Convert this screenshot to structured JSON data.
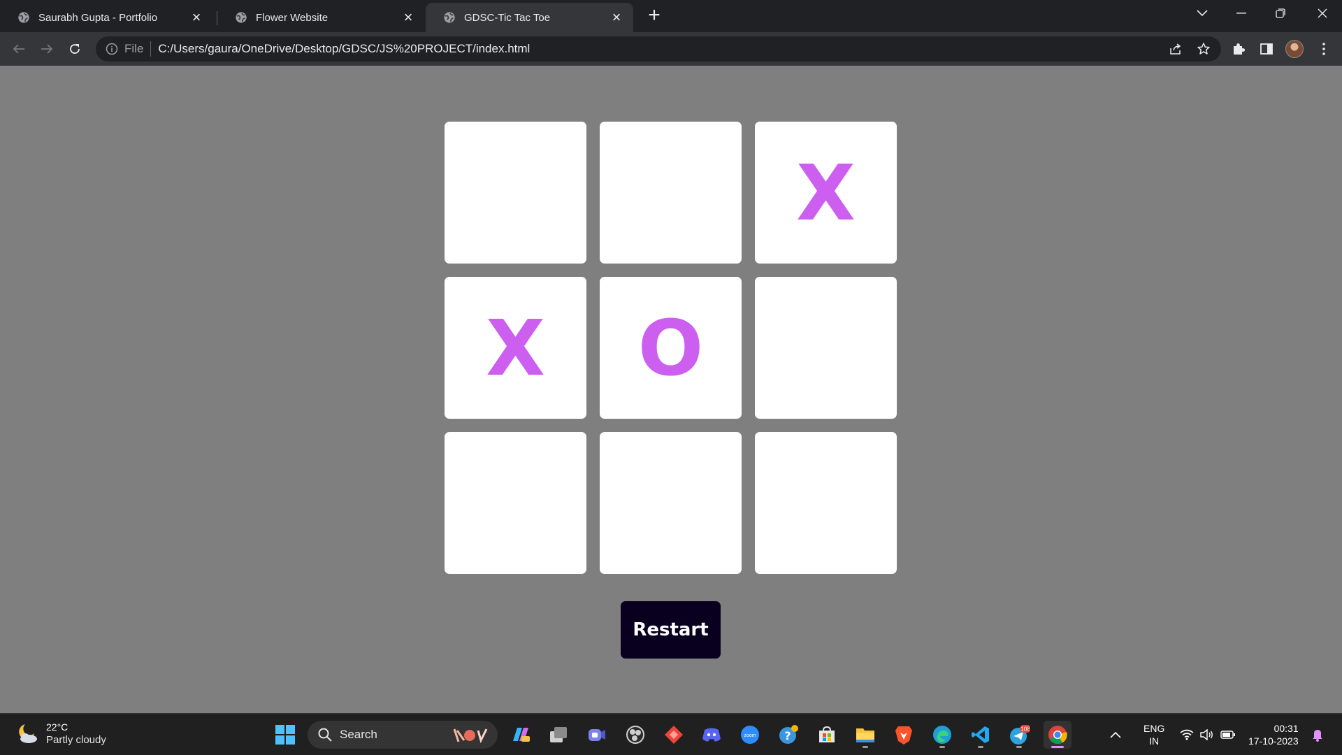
{
  "browser": {
    "tabs": [
      {
        "title": "Saurabh Gupta - Portfolio",
        "active": false
      },
      {
        "title": "Flower Website",
        "active": false
      },
      {
        "title": "GDSC-Tic Tac Toe",
        "active": true
      }
    ],
    "omnibox": {
      "scheme_label": "File",
      "url": "C:/Users/gaura/OneDrive/Desktop/GDSC/JS%20PROJECT/index.html"
    }
  },
  "game": {
    "cells": [
      "",
      "",
      "X",
      "X",
      "O",
      "",
      "",
      "",
      ""
    ],
    "mark_color": "#cc5ef0",
    "restart_label": "Restart",
    "button_color": "#08001e"
  },
  "taskbar": {
    "weather": {
      "temp": "22°C",
      "condition": "Partly cloudy"
    },
    "search_placeholder": "Search",
    "telegram_badge": "108",
    "language": {
      "line1": "ENG",
      "line2": "IN"
    },
    "clock": {
      "time": "00:31",
      "date": "17-10-2023"
    }
  }
}
